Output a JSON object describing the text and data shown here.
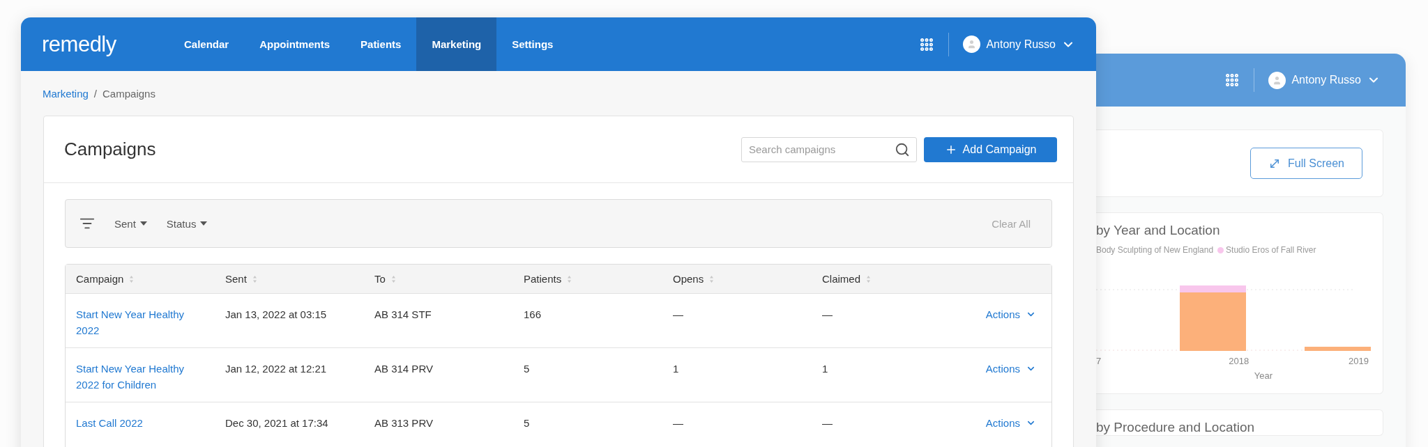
{
  "front_window": {
    "logo": "remedly",
    "nav": [
      {
        "label": "Calendar",
        "selected": false
      },
      {
        "label": "Appointments",
        "selected": false
      },
      {
        "label": "Patients",
        "selected": false
      },
      {
        "label": "Marketing",
        "selected": true
      },
      {
        "label": "Settings",
        "selected": false
      }
    ],
    "user": {
      "name": "Antony Russo"
    },
    "breadcrumb": {
      "items": [
        "Marketing",
        "Campaigns"
      ],
      "separator": "/"
    },
    "page_title": "Campaigns",
    "search": {
      "placeholder": "Search campaigns"
    },
    "add_button": "Add Campaign",
    "filters": {
      "items": [
        "Sent",
        "Status"
      ],
      "clear": "Clear All"
    },
    "table": {
      "columns": [
        "Campaign",
        "Sent",
        "To",
        "Patients",
        "Opens",
        "Claimed"
      ],
      "rows": [
        {
          "campaign": "Start New Year Healthy 2022",
          "sent": "Jan 13, 2022 at 03:15",
          "to": "AB 314 STF",
          "patients": "166",
          "opens": "—",
          "claimed": "—",
          "actions": "Actions"
        },
        {
          "campaign": "Start New Year Healthy 2022 for Children",
          "sent": "Jan 12, 2022 at 12:21",
          "to": "AB 314 PRV",
          "patients": "5",
          "opens": "1",
          "claimed": "1",
          "actions": "Actions"
        },
        {
          "campaign": "Last Call 2022",
          "sent": "Dec 30, 2021 at 17:34",
          "to": "AB 313 PRV",
          "patients": "5",
          "opens": "—",
          "claimed": "—",
          "actions": "Actions"
        }
      ]
    }
  },
  "back_window": {
    "user": {
      "name": "Antony Russo"
    },
    "full_screen_button": "Full Screen",
    "chart_card": {
      "title": "by Year and Location",
      "legend": [
        {
          "label": "Body Sculpting of New England"
        },
        {
          "label": "Studio Eros of Fall River",
          "color": "#f8c6ec"
        }
      ],
      "x_labels": [
        "7",
        "2018",
        "2019"
      ],
      "xlabel": "Year"
    },
    "next_card": {
      "title": "by Procedure and Location"
    }
  }
}
